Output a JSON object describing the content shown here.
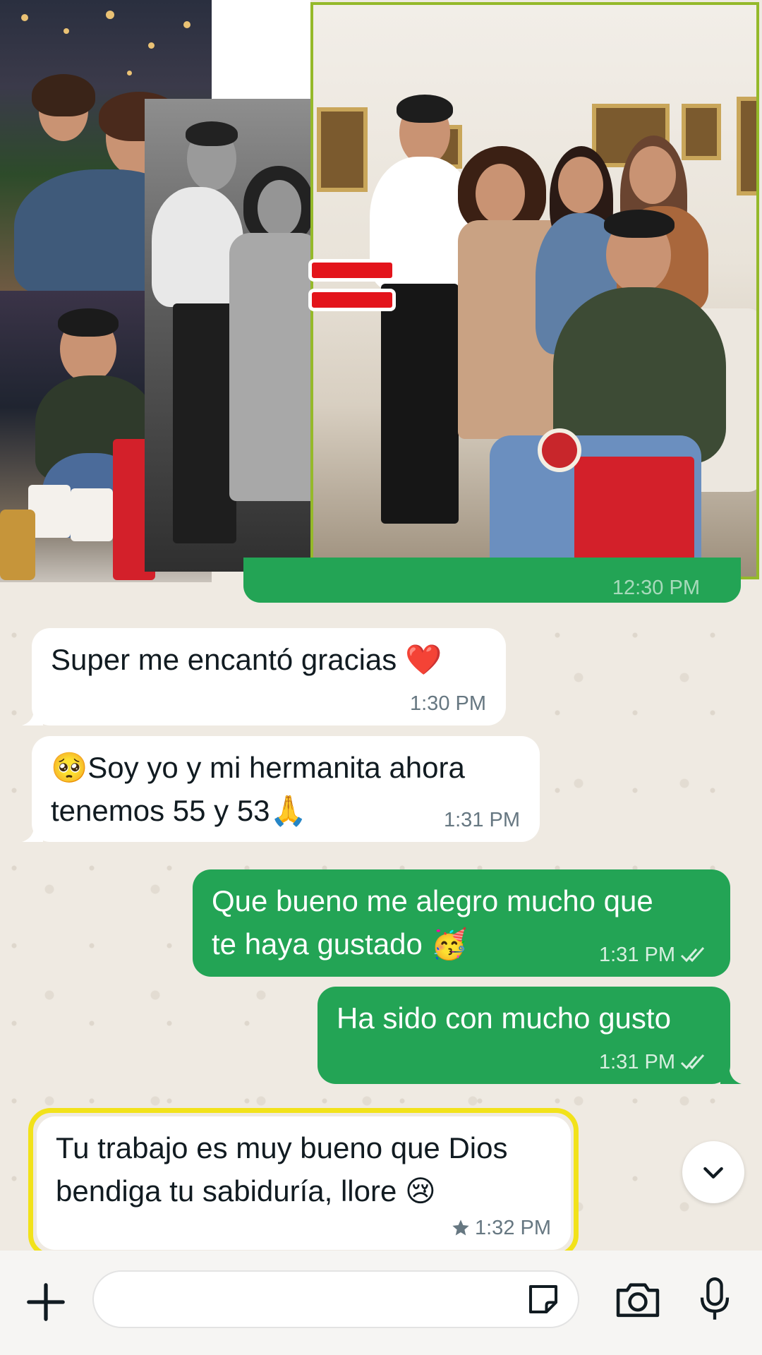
{
  "chat": {
    "partial_time": "12:30 PM",
    "messages": [
      {
        "direction": "incoming",
        "text": "Super me encantó gracias ❤️",
        "time": "1:30 PM"
      },
      {
        "direction": "incoming",
        "text": "🥺Soy yo y mi hermanita ahora\ntenemos 55 y 53🙏",
        "time": "1:31 PM"
      },
      {
        "direction": "outgoing",
        "text": "Que bueno me alegro mucho que\nte haya gustado 🥳",
        "time": "1:31 PM",
        "status": "read"
      },
      {
        "direction": "outgoing",
        "text": "Ha sido con mucho gusto",
        "time": "1:31 PM",
        "status": "read"
      },
      {
        "direction": "incoming",
        "text": "Tu trabajo es muy bueno que Dios\nbendiga tu sabiduría, llore 😢",
        "time": "1:32 PM",
        "starred": true,
        "highlighted": true
      }
    ]
  },
  "input_bar": {
    "placeholder": "",
    "icons": [
      "plus-icon",
      "sticker-icon",
      "camera-icon",
      "microphone-icon"
    ]
  },
  "scroll_button_icon": "chevron-down-icon",
  "colors": {
    "outgoing_bubble": "#23a455",
    "incoming_bubble": "#ffffff",
    "highlight": "#f2e21a",
    "photo_border": "#95b92a",
    "equal_sign": "#e3141b",
    "chat_background": "#efeae2"
  }
}
